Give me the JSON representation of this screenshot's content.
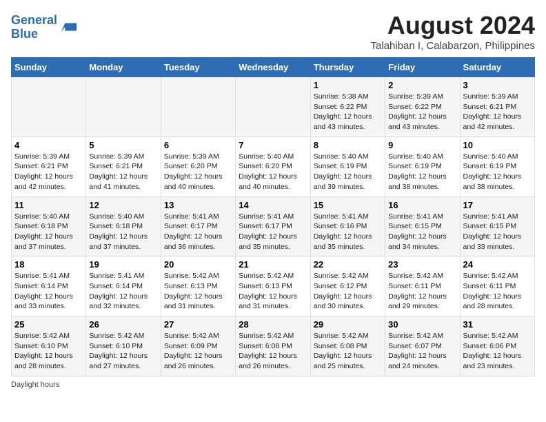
{
  "logo": {
    "line1": "General",
    "line2": "Blue"
  },
  "title": "August 2024",
  "subtitle": "Talahiban I, Calabarzon, Philippines",
  "header_color": "#2e6db4",
  "days_of_week": [
    "Sunday",
    "Monday",
    "Tuesday",
    "Wednesday",
    "Thursday",
    "Friday",
    "Saturday"
  ],
  "weeks": [
    [
      {
        "day": "",
        "content": ""
      },
      {
        "day": "",
        "content": ""
      },
      {
        "day": "",
        "content": ""
      },
      {
        "day": "",
        "content": ""
      },
      {
        "day": "1",
        "content": "Sunrise: 5:38 AM\nSunset: 6:22 PM\nDaylight: 12 hours\nand 43 minutes."
      },
      {
        "day": "2",
        "content": "Sunrise: 5:39 AM\nSunset: 6:22 PM\nDaylight: 12 hours\nand 43 minutes."
      },
      {
        "day": "3",
        "content": "Sunrise: 5:39 AM\nSunset: 6:21 PM\nDaylight: 12 hours\nand 42 minutes."
      }
    ],
    [
      {
        "day": "4",
        "content": "Sunrise: 5:39 AM\nSunset: 6:21 PM\nDaylight: 12 hours\nand 42 minutes."
      },
      {
        "day": "5",
        "content": "Sunrise: 5:39 AM\nSunset: 6:21 PM\nDaylight: 12 hours\nand 41 minutes."
      },
      {
        "day": "6",
        "content": "Sunrise: 5:39 AM\nSunset: 6:20 PM\nDaylight: 12 hours\nand 40 minutes."
      },
      {
        "day": "7",
        "content": "Sunrise: 5:40 AM\nSunset: 6:20 PM\nDaylight: 12 hours\nand 40 minutes."
      },
      {
        "day": "8",
        "content": "Sunrise: 5:40 AM\nSunset: 6:19 PM\nDaylight: 12 hours\nand 39 minutes."
      },
      {
        "day": "9",
        "content": "Sunrise: 5:40 AM\nSunset: 6:19 PM\nDaylight: 12 hours\nand 38 minutes."
      },
      {
        "day": "10",
        "content": "Sunrise: 5:40 AM\nSunset: 6:19 PM\nDaylight: 12 hours\nand 38 minutes."
      }
    ],
    [
      {
        "day": "11",
        "content": "Sunrise: 5:40 AM\nSunset: 6:18 PM\nDaylight: 12 hours\nand 37 minutes."
      },
      {
        "day": "12",
        "content": "Sunrise: 5:40 AM\nSunset: 6:18 PM\nDaylight: 12 hours\nand 37 minutes."
      },
      {
        "day": "13",
        "content": "Sunrise: 5:41 AM\nSunset: 6:17 PM\nDaylight: 12 hours\nand 36 minutes."
      },
      {
        "day": "14",
        "content": "Sunrise: 5:41 AM\nSunset: 6:17 PM\nDaylight: 12 hours\nand 35 minutes."
      },
      {
        "day": "15",
        "content": "Sunrise: 5:41 AM\nSunset: 6:16 PM\nDaylight: 12 hours\nand 35 minutes."
      },
      {
        "day": "16",
        "content": "Sunrise: 5:41 AM\nSunset: 6:15 PM\nDaylight: 12 hours\nand 34 minutes."
      },
      {
        "day": "17",
        "content": "Sunrise: 5:41 AM\nSunset: 6:15 PM\nDaylight: 12 hours\nand 33 minutes."
      }
    ],
    [
      {
        "day": "18",
        "content": "Sunrise: 5:41 AM\nSunset: 6:14 PM\nDaylight: 12 hours\nand 33 minutes."
      },
      {
        "day": "19",
        "content": "Sunrise: 5:41 AM\nSunset: 6:14 PM\nDaylight: 12 hours\nand 32 minutes."
      },
      {
        "day": "20",
        "content": "Sunrise: 5:42 AM\nSunset: 6:13 PM\nDaylight: 12 hours\nand 31 minutes."
      },
      {
        "day": "21",
        "content": "Sunrise: 5:42 AM\nSunset: 6:13 PM\nDaylight: 12 hours\nand 31 minutes."
      },
      {
        "day": "22",
        "content": "Sunrise: 5:42 AM\nSunset: 6:12 PM\nDaylight: 12 hours\nand 30 minutes."
      },
      {
        "day": "23",
        "content": "Sunrise: 5:42 AM\nSunset: 6:11 PM\nDaylight: 12 hours\nand 29 minutes."
      },
      {
        "day": "24",
        "content": "Sunrise: 5:42 AM\nSunset: 6:11 PM\nDaylight: 12 hours\nand 28 minutes."
      }
    ],
    [
      {
        "day": "25",
        "content": "Sunrise: 5:42 AM\nSunset: 6:10 PM\nDaylight: 12 hours\nand 28 minutes."
      },
      {
        "day": "26",
        "content": "Sunrise: 5:42 AM\nSunset: 6:10 PM\nDaylight: 12 hours\nand 27 minutes."
      },
      {
        "day": "27",
        "content": "Sunrise: 5:42 AM\nSunset: 6:09 PM\nDaylight: 12 hours\nand 26 minutes."
      },
      {
        "day": "28",
        "content": "Sunrise: 5:42 AM\nSunset: 6:08 PM\nDaylight: 12 hours\nand 26 minutes."
      },
      {
        "day": "29",
        "content": "Sunrise: 5:42 AM\nSunset: 6:08 PM\nDaylight: 12 hours\nand 25 minutes."
      },
      {
        "day": "30",
        "content": "Sunrise: 5:42 AM\nSunset: 6:07 PM\nDaylight: 12 hours\nand 24 minutes."
      },
      {
        "day": "31",
        "content": "Sunrise: 5:42 AM\nSunset: 6:06 PM\nDaylight: 12 hours\nand 23 minutes."
      }
    ]
  ],
  "footer": {
    "daylight_label": "Daylight hours"
  }
}
